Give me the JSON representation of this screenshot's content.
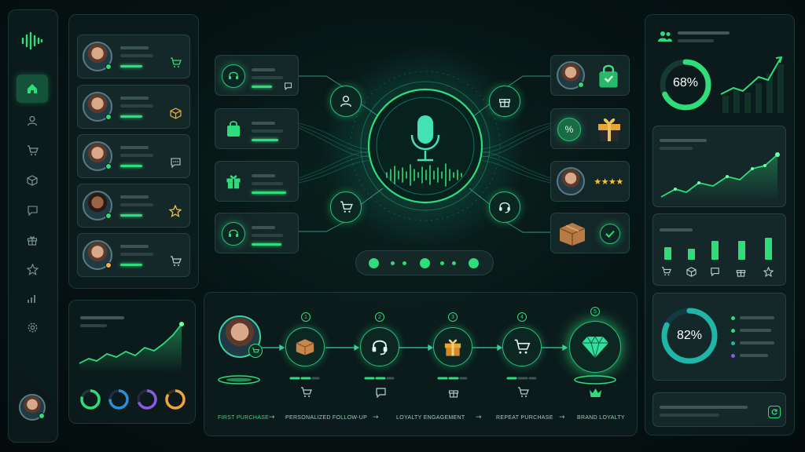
{
  "theme": {
    "accent": "#2fdc7a",
    "accent_alt": "#1fb5a8",
    "background": "#061414",
    "avatar_status_yellow": "#f3b33d",
    "donut_colors": [
      "#2fdc7a",
      "#2a8fd6",
      "#8a5be0",
      "#f0a53b"
    ]
  },
  "app": {
    "logo_icon": "sound-wave-icon"
  },
  "sidebar": {
    "items": [
      {
        "name": "home",
        "icon": "home-icon",
        "active": true
      },
      {
        "name": "users",
        "icon": "user-icon"
      },
      {
        "name": "cart",
        "icon": "cart-icon"
      },
      {
        "name": "packages",
        "icon": "box-icon"
      },
      {
        "name": "messages",
        "icon": "chat-icon"
      },
      {
        "name": "gifts",
        "icon": "gift-icon"
      },
      {
        "name": "favorites",
        "icon": "star-icon"
      },
      {
        "name": "analytics",
        "icon": "bar-chart-icon"
      },
      {
        "name": "settings",
        "icon": "gear-icon"
      }
    ]
  },
  "customers": [
    {
      "status": "online",
      "icon": "cart-icon"
    },
    {
      "status": "online",
      "icon": "box-icon"
    },
    {
      "status": "online",
      "icon": "chat-icon"
    },
    {
      "status": "online",
      "icon": "star-icon"
    },
    {
      "status": "away",
      "icon": "cart-icon"
    }
  ],
  "mini_chart": {
    "donuts": 4
  },
  "input_channels": [
    {
      "icon": "headset-icon"
    },
    {
      "icon": "bag-icon"
    },
    {
      "icon": "gift-icon"
    },
    {
      "icon": "headset-icon"
    }
  ],
  "hub": {
    "icon": "microphone-icon",
    "nodes": [
      "user-icon",
      "gift-icon",
      "cart-icon",
      "headset-icon"
    ]
  },
  "outputs": [
    {
      "icon": "shopping-bag-icon"
    },
    {
      "icon": "discount-gift-icon"
    },
    {
      "icon": "rating-stars-icon",
      "stars": "★★★★"
    },
    {
      "icon": "package-check-icon"
    }
  ],
  "journey": {
    "steps": [
      {
        "num": "1",
        "icon": "box-icon",
        "sub_icon": "cart-icon"
      },
      {
        "num": "2",
        "icon": "headset-icon",
        "sub_icon": "chat-icon"
      },
      {
        "num": "3",
        "icon": "gift-icon",
        "sub_icon": "gift-icon"
      },
      {
        "num": "4",
        "icon": "cart-icon",
        "sub_icon": "cart-icon"
      },
      {
        "num": "5",
        "icon": "diamond-icon",
        "sub_icon": "crown-icon"
      }
    ],
    "labels": [
      "FIRST PURCHASE",
      "PERSONALIZED FOLLOW-UP",
      "LOYALTY ENGAGEMENT",
      "REPEAT PURCHASE",
      "BRAND LOYALTY"
    ]
  },
  "stats": {
    "top_percent": "68%",
    "top_value": 0.68,
    "bottom_percent": "82%",
    "bottom_value": 0.82,
    "bar_icons": [
      "cart-icon",
      "box-icon",
      "chat-icon",
      "gift-icon",
      "star-icon"
    ]
  }
}
